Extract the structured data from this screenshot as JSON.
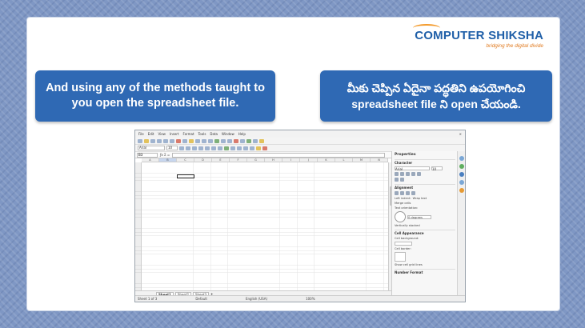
{
  "logo": {
    "title_part1": "COMPUTER",
    "title_part2": "SHIKSHA",
    "tagline": "bridging the digital divide"
  },
  "banners": {
    "english": "And using any of the methods taught to you open the spreadsheet file.",
    "telugu": "మీకు చెప్పిన ఏదైనా పద్ధతిని ఉపయోగించి spreadsheet file ని open చేయండి."
  },
  "app": {
    "menus": [
      "File",
      "Edit",
      "View",
      "Insert",
      "Format",
      "Tools",
      "Data",
      "Window",
      "Help"
    ],
    "font_name": "Arial",
    "font_size": "10",
    "name_box": "B3",
    "columns": [
      "A",
      "B",
      "C",
      "D",
      "E",
      "F",
      "G",
      "H",
      "I",
      "J",
      "K",
      "L",
      "M",
      "N"
    ],
    "sheet_tabs": [
      "Sheet1",
      "Sheet2",
      "Sheet3"
    ],
    "status": {
      "sheet": "Sheet 1 of 3",
      "style": "Default",
      "language": "English (USA)",
      "zoom": "100%"
    },
    "sidebar": {
      "title": "Properties",
      "sections": [
        "Character",
        "Alignment",
        "Cell Appearance",
        "Number Format"
      ],
      "labels": [
        "Left indent:",
        "Wrap text",
        "Merge cells",
        "Text orientation:",
        "0 degrees",
        "Vertically stacked",
        "Cell background:",
        "Cell border:",
        "Show cell grid lines"
      ]
    }
  }
}
